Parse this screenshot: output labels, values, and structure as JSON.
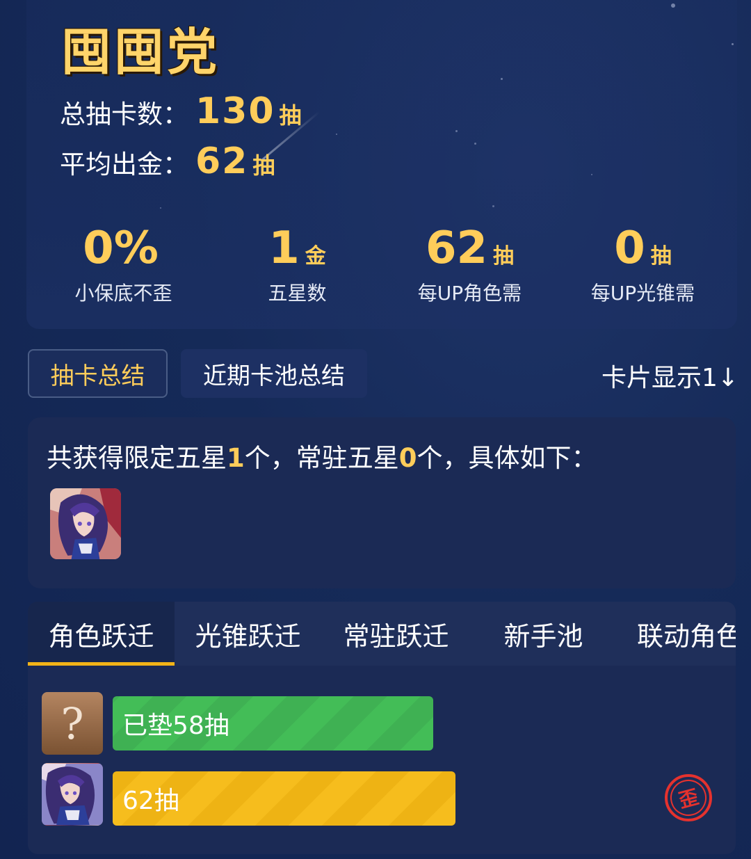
{
  "title": "囤囤党",
  "stats": {
    "total_label": "总抽卡数：",
    "total_value": "130",
    "total_unit": "抽",
    "avg_label": "平均出金：",
    "avg_value": "62",
    "avg_unit": "抽"
  },
  "metrics": [
    {
      "value": "0%",
      "unit": "",
      "caption": "小保底不歪"
    },
    {
      "value": "1",
      "unit": "金",
      "caption": "五星数"
    },
    {
      "value": "62",
      "unit": "抽",
      "caption": "每UP角色需"
    },
    {
      "value": "0",
      "unit": "抽",
      "caption": "每UP光锥需"
    }
  ],
  "tabs": {
    "summary": "抽卡总结",
    "recent": "近期卡池总结",
    "card_display": "卡片显示1↓"
  },
  "summary": {
    "prefix": "共获得限定五星",
    "limited_count": "1",
    "mid": "个，常驻五星",
    "standard_count": "0",
    "suffix": "个，具体如下："
  },
  "pool_tabs": [
    "角色跃迁",
    "光锥跃迁",
    "常驻跃迁",
    "新手池",
    "联动角色"
  ],
  "pool_rows": [
    {
      "icon": "unknown-icon",
      "icon_text": "?",
      "label": "已垫58抽",
      "pulls": 58,
      "color": "#43bd57"
    },
    {
      "icon": "character-avatar",
      "label": "62抽",
      "pulls": 62,
      "color": "#f6bd1d",
      "badge": "歪"
    }
  ],
  "colors": {
    "accent": "#ffcd5a",
    "tab_underline": "#f2b318",
    "badge_red": "#e5322e"
  }
}
